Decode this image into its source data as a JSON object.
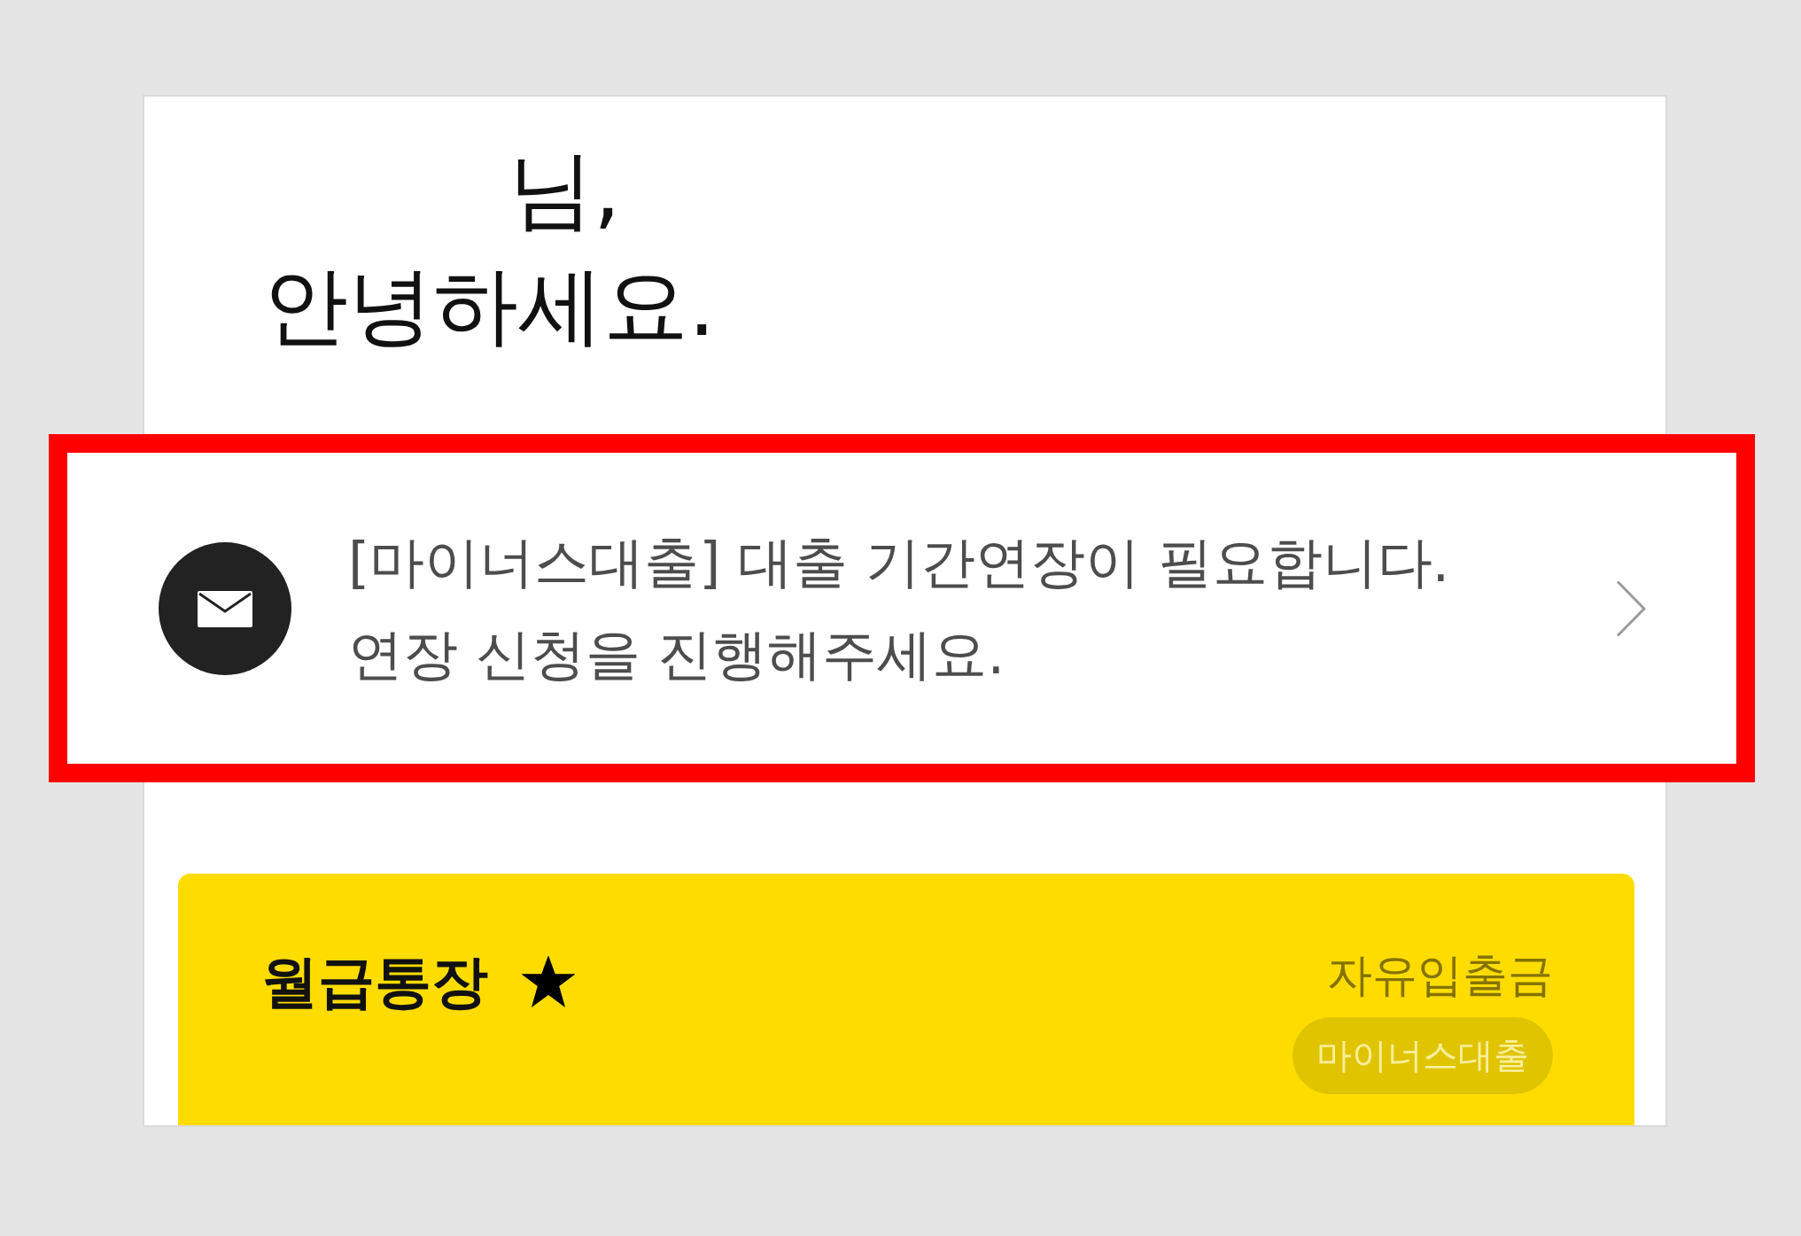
{
  "greeting": {
    "name_suffix": "님,",
    "salutation": "안녕하세요."
  },
  "notice": {
    "message": [
      "[마이너스대출] 대출 기간연장이 필요합니다.",
      "연장 신청을 진행해주세요."
    ]
  },
  "account_card": {
    "name": "월급통장",
    "favorite": true,
    "type": "자유입출금",
    "badge": "마이너스대출"
  }
}
